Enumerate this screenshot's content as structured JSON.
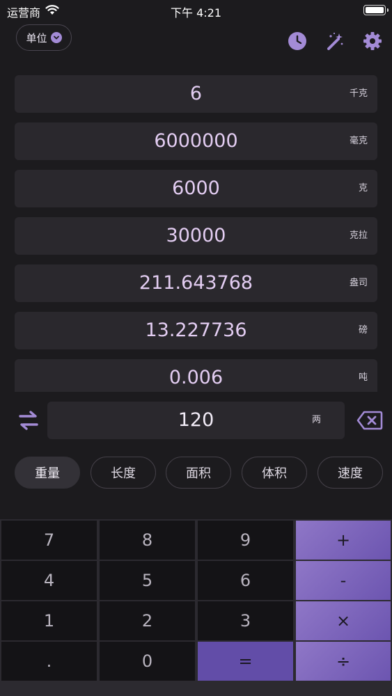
{
  "status_bar": {
    "carrier": "运营商",
    "time": "下午 4:21"
  },
  "toolbar": {
    "unit_label": "单位",
    "icons": [
      "history-icon",
      "magic-wand-icon",
      "gear-icon"
    ],
    "accent_color": "#a38bd6"
  },
  "results": [
    {
      "value": "6",
      "unit": "千克"
    },
    {
      "value": "6000000",
      "unit": "毫克"
    },
    {
      "value": "6000",
      "unit": "克"
    },
    {
      "value": "30000",
      "unit": "克拉"
    },
    {
      "value": "211.643768",
      "unit": "盎司"
    },
    {
      "value": "13.227736",
      "unit": "磅"
    },
    {
      "value": "0.006",
      "unit": "吨"
    }
  ],
  "input": {
    "value": "120",
    "unit": "两"
  },
  "categories": [
    {
      "label": "重量",
      "active": true
    },
    {
      "label": "长度",
      "active": false
    },
    {
      "label": "面积",
      "active": false
    },
    {
      "label": "体积",
      "active": false
    },
    {
      "label": "速度",
      "active": false
    }
  ],
  "keypad": {
    "keys": [
      {
        "label": "7",
        "type": "digit"
      },
      {
        "label": "8",
        "type": "digit"
      },
      {
        "label": "9",
        "type": "digit"
      },
      {
        "label": "+",
        "type": "op"
      },
      {
        "label": "4",
        "type": "digit"
      },
      {
        "label": "5",
        "type": "digit"
      },
      {
        "label": "6",
        "type": "digit"
      },
      {
        "label": "-",
        "type": "op"
      },
      {
        "label": "1",
        "type": "digit"
      },
      {
        "label": "2",
        "type": "digit"
      },
      {
        "label": "3",
        "type": "digit"
      },
      {
        "label": "×",
        "type": "op"
      },
      {
        "label": ".",
        "type": "digit"
      },
      {
        "label": "0",
        "type": "digit"
      },
      {
        "label": "=",
        "type": "eq"
      },
      {
        "label": "÷",
        "type": "op"
      }
    ]
  }
}
